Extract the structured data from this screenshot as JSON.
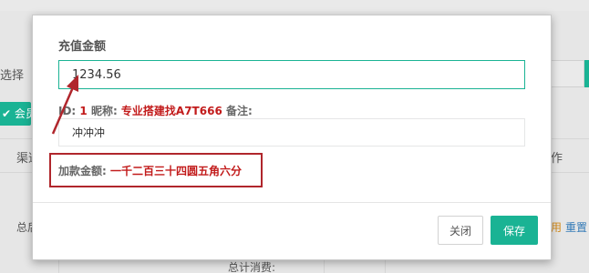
{
  "background": {
    "select_label": "选择",
    "member_button": "✔ 会员B",
    "table_header_channel": "渠道",
    "table_header_ops": "作",
    "row_name": "总后",
    "row_op_enable": "用",
    "row_op_reset": "重置",
    "bottom_stat": "总计消费:"
  },
  "modal": {
    "amount_label": "充值金额",
    "amount_value": "1234.56",
    "info_id_prefix": "ID: ",
    "info_id": "1",
    "info_nick_prefix": " 昵称: ",
    "info_nick": "专业搭建找A7T666",
    "info_note_prefix": " 备注:",
    "note_value": "冲冲冲",
    "cn_amount_label": "加款金额: ",
    "cn_amount_value": "一千二百三十四圆五角六分",
    "close_button": "关闭",
    "save_button": "保存"
  },
  "colors": {
    "accent": "#1ab394",
    "highlight_red": "#c21b1b",
    "annotation_red": "#b0262c"
  }
}
